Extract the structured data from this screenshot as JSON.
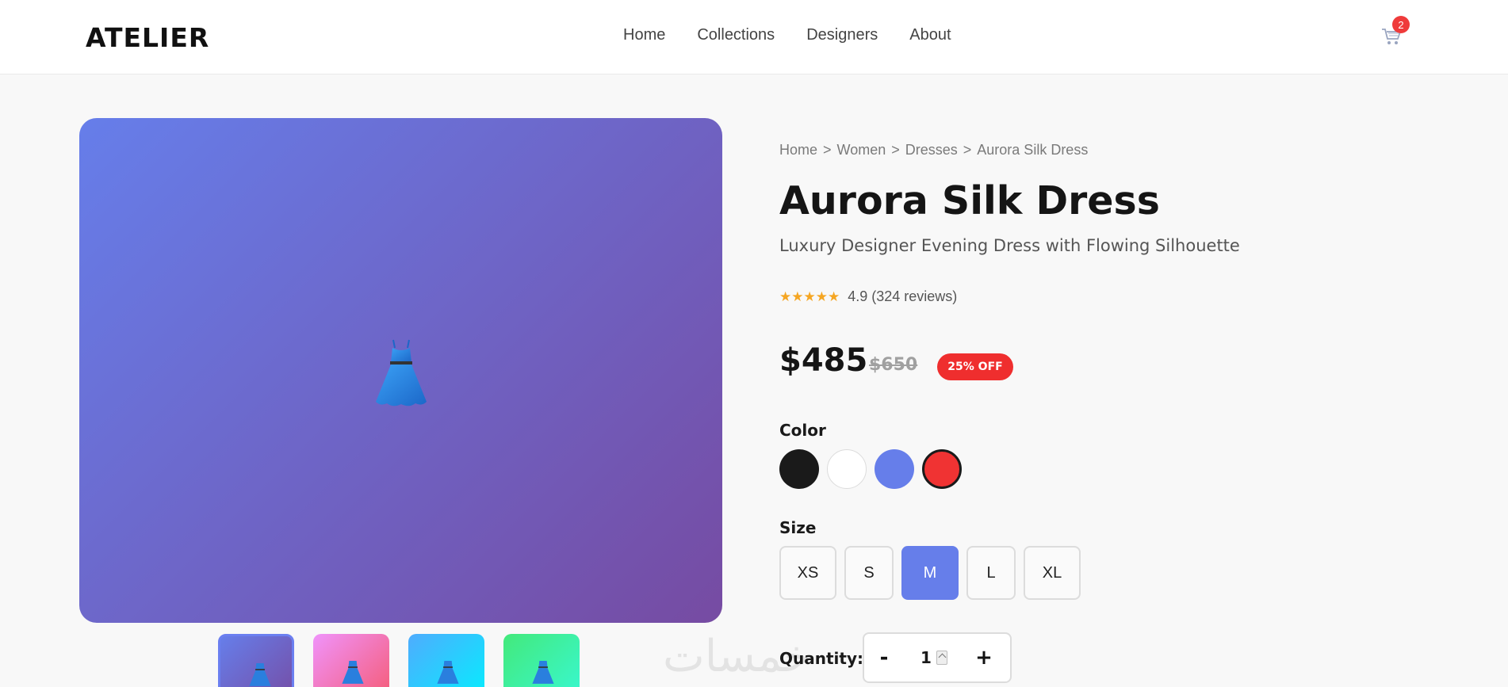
{
  "header": {
    "logo": "ATELIER",
    "nav": [
      "Home",
      "Collections",
      "Designers",
      "About"
    ],
    "cart_count": "2",
    "cart_icon": "cart-icon"
  },
  "gallery": {
    "main_icon": "dress-icon",
    "thumbnails": [
      {
        "color_from": "#667eea",
        "color_to": "#764ba2"
      },
      {
        "color_from": "#f093fb",
        "color_to": "#f5576c"
      },
      {
        "color_from": "#4facfe",
        "color_to": "#00f2fe"
      },
      {
        "color_from": "#43e97b",
        "color_to": "#38f9d7"
      }
    ]
  },
  "product": {
    "breadcrumb": [
      "Home",
      ">",
      "Women",
      ">",
      "Dresses",
      ">",
      "Aurora Silk Dress"
    ],
    "title": "Aurora Silk Dress",
    "subtitle": "Luxury Designer Evening Dress with Flowing Silhouette",
    "stars": "★★★★★",
    "rating_text": "4.9 (324 reviews)",
    "price": "$485",
    "old_price": "$650",
    "discount": "25% OFF",
    "color_label": "Color",
    "colors": [
      "#1a1a1a",
      "#ffffff",
      "#667eea",
      "#f03333"
    ],
    "selected_color": "#f03333",
    "size_label": "Size",
    "sizes": [
      "XS",
      "S",
      "M",
      "L",
      "XL"
    ],
    "selected_size": "M",
    "quantity_label": "Quantity:",
    "quantity": "1",
    "minus": "-",
    "plus": "+"
  },
  "watermark": "خمسات"
}
